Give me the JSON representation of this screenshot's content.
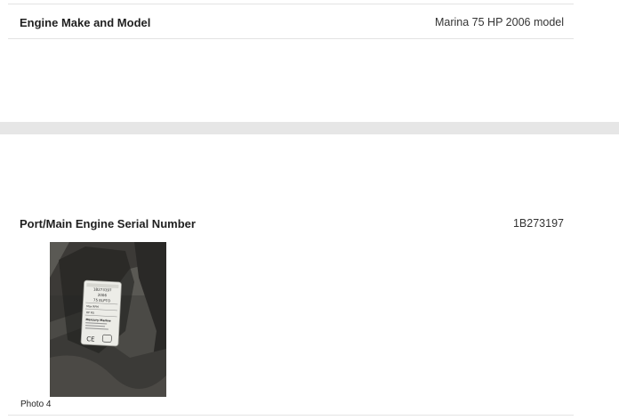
{
  "engine_make_model": {
    "label": "Engine Make and Model",
    "value": "Marina 75 HP 2006 model"
  },
  "serial_number": {
    "label": "Port/Main Engine Serial Number",
    "value": "1B273197"
  },
  "photo": {
    "caption": "Photo 4",
    "plate_lines": [
      "1B273197",
      "2006",
      "75 ELPTO",
      "Max RPM",
      "HP RS",
      "Mercury Marine"
    ],
    "ce_mark": "CE"
  }
}
